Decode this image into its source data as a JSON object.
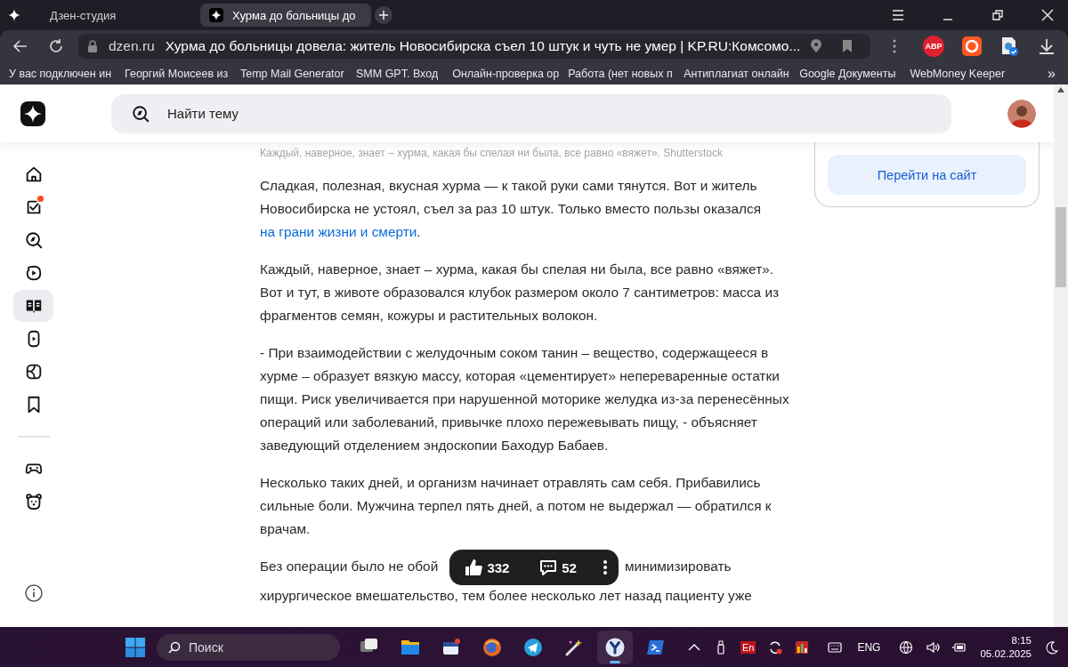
{
  "browser": {
    "tabs": [
      {
        "label": "Дзен-студия",
        "selected": false
      },
      {
        "label": "Хурма до больницы до",
        "selected": true
      }
    ],
    "address": {
      "domain": "dzen.ru",
      "title": "Хурма до больницы довела: житель Новосибирска съел 10 штук и чуть не умер | KP.RU:Комсомо..."
    },
    "extensions": [
      {
        "kind": "abp",
        "label": "ABP"
      },
      {
        "kind": "record"
      },
      {
        "kind": "doc"
      }
    ],
    "bookmarks": [
      "У вас подключен ин",
      "Георгий Моисеев из",
      "Temp Mail Generator",
      "SMM GPT. Вход",
      "Онлайн-проверка ор",
      "Работа (нет новых п",
      "Антиплагиат онлайн",
      "Google Документы",
      "WebMoney Keeper"
    ],
    "bookmarks_more": "»"
  },
  "page": {
    "search": {
      "placeholder": "Найти тему"
    },
    "nav": [
      {
        "kind": "home",
        "selected": false,
        "badge": false
      },
      {
        "kind": "subscriptions",
        "selected": false,
        "badge": true
      },
      {
        "kind": "explore",
        "selected": false,
        "badge": false
      },
      {
        "kind": "video",
        "selected": false,
        "badge": false
      },
      {
        "kind": "articles",
        "selected": true,
        "badge": false
      },
      {
        "kind": "shorts",
        "selected": false,
        "badge": false
      },
      {
        "kind": "studio",
        "selected": false,
        "badge": false
      },
      {
        "kind": "bookmarks",
        "selected": false,
        "badge": false
      },
      {
        "kind": "divider"
      },
      {
        "kind": "games",
        "selected": false,
        "badge": false
      },
      {
        "kind": "kids",
        "selected": false,
        "badge": false
      }
    ],
    "caption": "Каждый, наверное, знает – хурма, какая бы спелая ни была, все равно «вяжет». Shutterstock",
    "paragraphs": [
      {
        "kind": "link",
        "text": "Сладкая, полезная, вкусная хурма — к такой руки сами тянутся. Вот и житель Новосибирска не устоял, съел за раз 10 штук. Только вместо пользы оказался",
        "link": "на грани жизни и смерти",
        "tail": "."
      },
      {
        "kind": "plain",
        "text": "Каждый, наверное, знает – хурма, какая бы спелая ни была, все равно «вяжет». Вот и тут, в животе образовался клубок размером около 7 сантиметров: масса из фрагментов семян, кожуры и растительных волокон."
      },
      {
        "kind": "plain",
        "text": "- При взаимодействии с желудочным соком танин – вещество, содержащееся в хурме – образует вязкую массу, которая «цементирует» непереваренные остатки пищи. Риск увеличивается при нарушенной моторике желудка из-за перенесённых операций или заболеваний, привычке плохо пережевывать пищу, - объясняет заведующий отделением эндоскопии Баходур Бабаев."
      },
      {
        "kind": "plain",
        "text": "Несколько таких дней, и организм начинает отравлять сам себя. Прибавились сильные боли. Мужчина терпел пять дней, а потом не выдержал — обратился к врачам."
      },
      {
        "kind": "covered",
        "parts": [
          "Без операции было не обой",
          "минимизировать"
        ],
        "line2": "хирургическое вмешательство, тем более несколько лет назад пациенту уже"
      }
    ],
    "site_button": "Перейти на сайт",
    "reactions": {
      "likes": "332",
      "comments": "52"
    }
  },
  "taskbar": {
    "search_placeholder": "Поиск",
    "apps": [
      {
        "kind": "taskview",
        "selected": false
      },
      {
        "kind": "folder",
        "selected": false
      },
      {
        "kind": "calendar",
        "selected": false
      },
      {
        "kind": "globe",
        "selected": false
      },
      {
        "kind": "telegram",
        "selected": false
      },
      {
        "kind": "wand",
        "selected": false
      },
      {
        "kind": "ybrowser",
        "selected": true
      },
      {
        "kind": "terminal",
        "selected": false
      }
    ],
    "tray_badge": "En",
    "language": "ENG",
    "time": "8:15",
    "date": "05.02.2025"
  }
}
